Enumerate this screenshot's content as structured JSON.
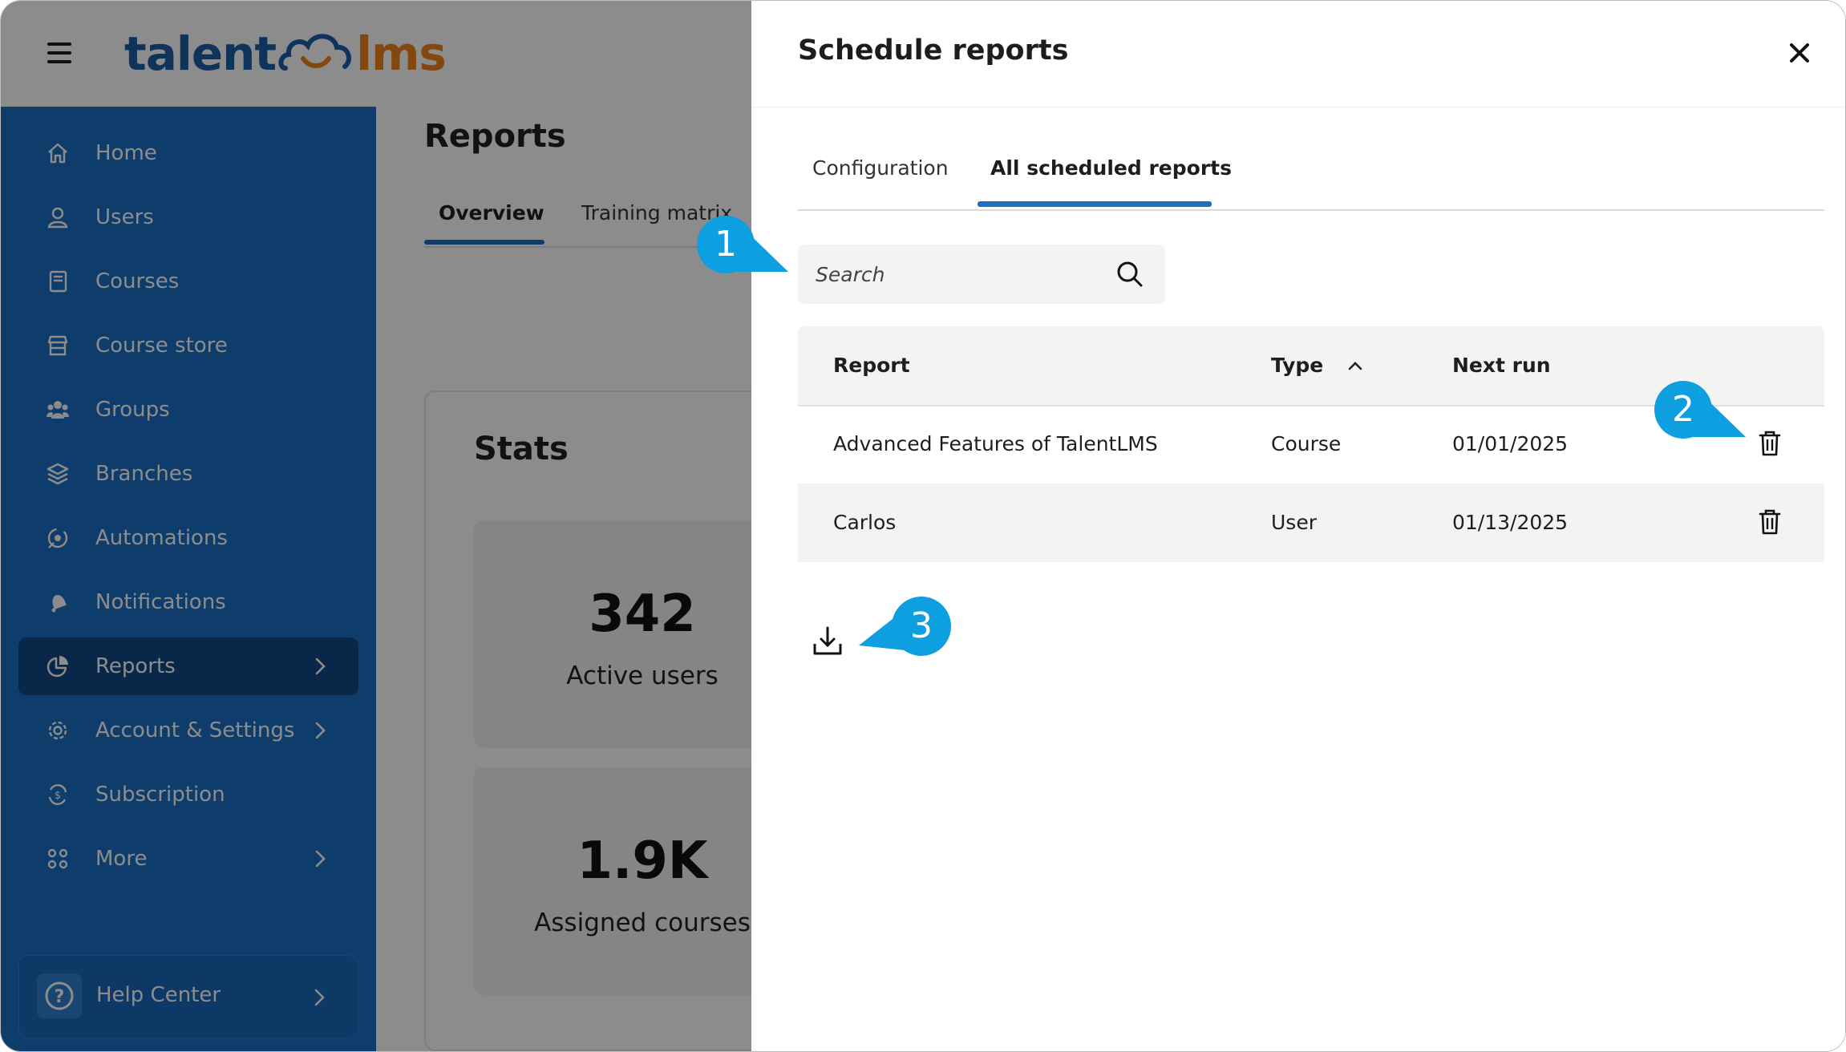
{
  "brand": {
    "logo_left": "talent",
    "logo_right": "lms"
  },
  "sidebar": {
    "items": [
      {
        "label": "Home",
        "icon": "home-icon"
      },
      {
        "label": "Users",
        "icon": "user-icon"
      },
      {
        "label": "Courses",
        "icon": "book-icon"
      },
      {
        "label": "Course store",
        "icon": "store-icon"
      },
      {
        "label": "Groups",
        "icon": "groups-icon"
      },
      {
        "label": "Branches",
        "icon": "layers-icon"
      },
      {
        "label": "Automations",
        "icon": "automation-icon"
      },
      {
        "label": "Notifications",
        "icon": "bell-icon"
      },
      {
        "label": "Reports",
        "icon": "pie-chart-icon",
        "active": true
      },
      {
        "label": "Account & Settings",
        "icon": "gear-icon"
      },
      {
        "label": "Subscription",
        "icon": "subscription-icon"
      },
      {
        "label": "More",
        "icon": "apps-icon"
      }
    ],
    "help": "Help Center"
  },
  "main": {
    "title": "Reports",
    "tabs": [
      "Overview",
      "Training matrix"
    ],
    "stats": {
      "title": "Stats",
      "cards": [
        {
          "value": "342",
          "label": "Active users"
        },
        {
          "value": "1.9K",
          "label": "Assigned courses"
        }
      ]
    }
  },
  "drawer": {
    "title": "Schedule reports",
    "tabs": [
      "Configuration",
      "All scheduled reports"
    ],
    "active_tab": "All scheduled reports",
    "search": {
      "placeholder": "Search",
      "value": ""
    },
    "columns": [
      "Report",
      "Type",
      "Next run"
    ],
    "rows": [
      {
        "report": "Advanced Features of TalentLMS",
        "type": "Course",
        "next_run": "01/01/2025"
      },
      {
        "report": "Carlos",
        "type": "User",
        "next_run": "01/13/2025"
      }
    ]
  },
  "callouts": [
    "1",
    "2",
    "3"
  ],
  "colors": {
    "sidebar": "#1d6fc4",
    "sidebar_active": "#124a86",
    "accent": "#1d6fc4",
    "callout": "#0e9fe0",
    "logo_blue": "#1a5fa8",
    "logo_orange": "#f0821e"
  }
}
